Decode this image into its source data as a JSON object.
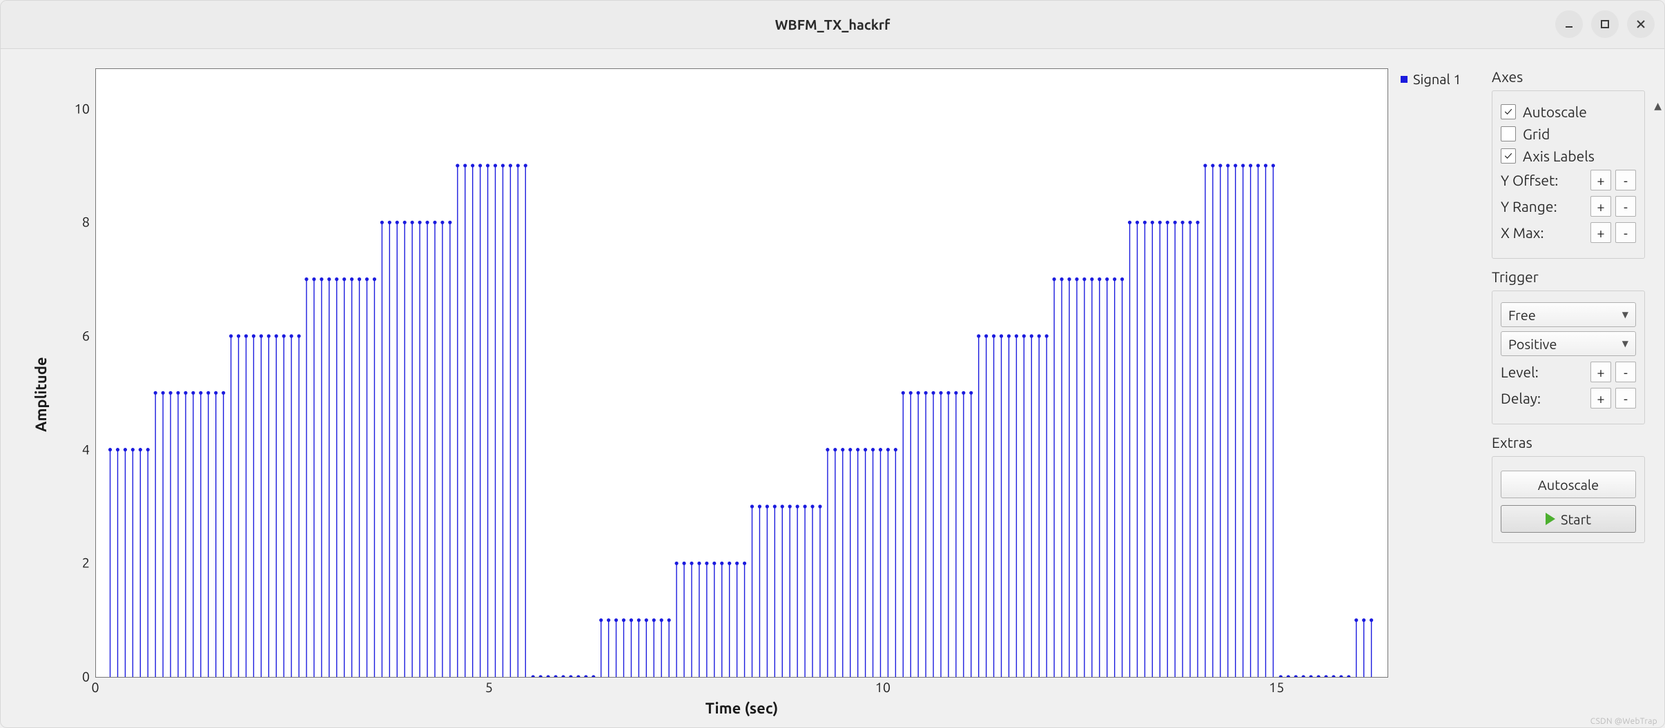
{
  "window": {
    "title": "WBFM_TX_hackrf"
  },
  "legend": {
    "label": "Signal 1"
  },
  "axes_panel": {
    "title": "Axes",
    "autoscale": "Autoscale",
    "autoscale_checked": true,
    "grid": "Grid",
    "grid_checked": false,
    "axis_labels": "Axis Labels",
    "axis_labels_checked": true,
    "y_offset": "Y Offset:",
    "y_range": "Y Range:",
    "x_max": "X Max:"
  },
  "trigger_panel": {
    "title": "Trigger",
    "mode": "Free",
    "slope": "Positive",
    "level": "Level:",
    "delay": "Delay:"
  },
  "extras_panel": {
    "title": "Extras",
    "autoscale": "Autoscale",
    "start": "Start"
  },
  "watermark": "CSDN @WebTrap",
  "chart_data": {
    "type": "stem",
    "title": "",
    "xlabel": "Time (sec)",
    "ylabel": "Amplitude",
    "xlim": [
      0,
      16.4
    ],
    "ylim": [
      0,
      10.7
    ],
    "x_ticks": [
      0,
      5,
      10,
      15
    ],
    "y_ticks": [
      0,
      2,
      4,
      6,
      8,
      10
    ],
    "series_name": "Signal 1",
    "color": "#1b1bde",
    "pattern_step_x": 0.0959,
    "pattern_values": [
      4,
      4,
      4,
      4,
      4,
      4,
      5,
      5,
      5,
      5,
      5,
      5,
      5,
      5,
      5,
      5,
      6,
      6,
      6,
      6,
      6,
      6,
      6,
      6,
      6,
      6,
      7,
      7,
      7,
      7,
      7,
      7,
      7,
      7,
      7,
      7,
      8,
      8,
      8,
      8,
      8,
      8,
      8,
      8,
      8,
      8,
      9,
      9,
      9,
      9,
      9,
      9,
      9,
      9,
      9,
      9,
      0,
      0,
      0,
      0,
      0,
      0,
      0,
      0,
      0,
      1,
      1,
      1,
      1,
      1,
      1,
      1,
      1,
      1,
      1,
      2,
      2,
      2,
      2,
      2,
      2,
      2,
      2,
      2,
      2,
      3,
      3,
      3,
      3,
      3,
      3,
      3,
      3,
      3,
      3,
      4,
      4,
      4,
      4,
      4,
      4,
      4,
      4,
      4,
      4,
      5,
      5,
      5,
      5,
      5,
      5,
      5,
      5,
      5,
      5,
      6,
      6,
      6,
      6,
      6,
      6,
      6,
      6,
      6,
      6,
      7,
      7,
      7,
      7,
      7,
      7,
      7,
      7,
      7,
      7,
      8,
      8,
      8,
      8,
      8,
      8,
      8,
      8,
      8,
      8,
      9,
      9,
      9,
      9,
      9,
      9,
      9,
      9,
      9,
      9,
      0,
      0,
      0,
      0,
      0,
      0,
      0,
      0,
      0,
      0,
      1,
      1,
      1
    ]
  }
}
